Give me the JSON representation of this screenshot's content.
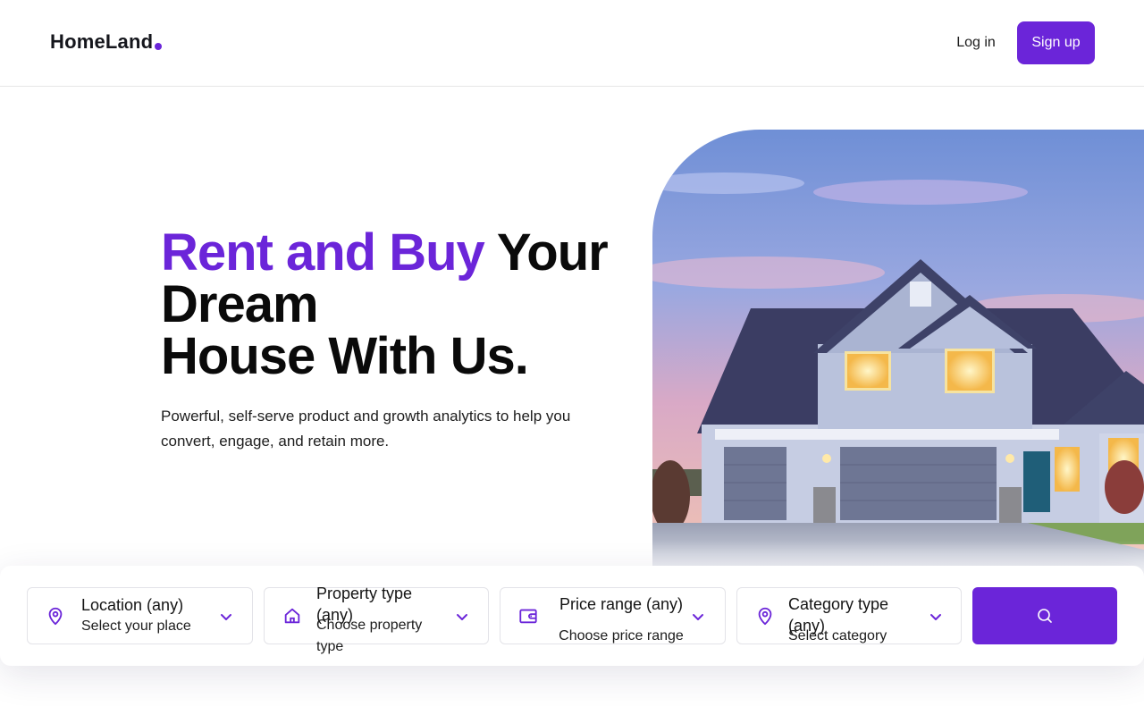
{
  "colors": {
    "accent": "#6b25d9",
    "text": "#0a0a0a"
  },
  "header": {
    "logo": "HomeLand",
    "login_label": "Log in",
    "signup_label": "Sign up"
  },
  "hero": {
    "title_accent": "Rent and Buy",
    "title_rest_line1": " Your",
    "title_line2": "Dream",
    "title_line3": "House With Us.",
    "subtitle": "Powerful, self-serve product and growth analytics to help you convert, engage, and retain more."
  },
  "search": {
    "fields": [
      {
        "icon": "map-pin-icon",
        "title": "Location (any)",
        "subtitle": "Select your place"
      },
      {
        "icon": "home-icon",
        "title": "Property type (any)",
        "subtitle": "Choose property type"
      },
      {
        "icon": "wallet-icon",
        "title": "Price range (any)",
        "subtitle": "Choose price range"
      },
      {
        "icon": "map-pin-icon",
        "title": "Category type (any)",
        "subtitle": "Select category"
      }
    ],
    "button_icon": "search-icon"
  }
}
